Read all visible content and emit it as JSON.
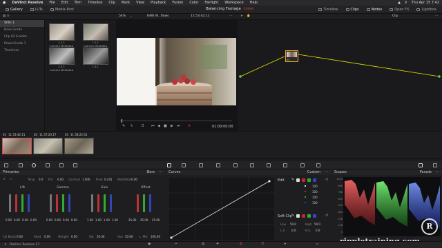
{
  "menubar": {
    "app": "DaVinci Resolve",
    "items": [
      "File",
      "Edit",
      "Trim",
      "Timeline",
      "Clip",
      "Mark",
      "View",
      "Playback",
      "Fusion",
      "Color",
      "Fairlight",
      "Workspace",
      "Help"
    ],
    "clock": "Thu Apr 15 7:42"
  },
  "toolbar": {
    "left": [
      "Gallery",
      "LUTs",
      "Media Pool"
    ],
    "project": "Balancing Footage",
    "edited": "Edited",
    "right": [
      "Timeline",
      "Clips",
      "Nodes",
      "Open FX",
      "Lightbox"
    ]
  },
  "viewer": {
    "zoom": "54%",
    "clip_name": "RAW W...flows",
    "timecode": "11:53:42:11",
    "playhead_tc": "01:00:00:00"
  },
  "nodes": {
    "mode": "Clip",
    "node_label": "01"
  },
  "sidebar": {
    "items": [
      "Stills 1",
      "Base Grade",
      "Clip 02 Grades",
      "PowerGrade 1",
      "Timelines"
    ]
  },
  "gallery": {
    "stills": [
      {
        "num": "1.1.1",
        "name": "Camera Metadata"
      },
      {
        "num": "1.2.1",
        "name": "Camera Metadata"
      },
      {
        "num": "1.3.1",
        "name": "Camera Metadata"
      },
      {
        "num": "1.4.1",
        "name": ""
      }
    ]
  },
  "timeline": {
    "clips": [
      {
        "index": "01",
        "tc": "11:53:42:11"
      },
      {
        "index": "02",
        "tc": "11:57:20:17"
      },
      {
        "index": "03",
        "tc": "11:58:22:01"
      }
    ]
  },
  "primaries": {
    "title": "Primaries",
    "mode": "Bars",
    "temp_label": "Temp",
    "temp": "0.0",
    "tint_label": "Tint",
    "tint": "0.00",
    "contrast_label": "Contrast",
    "contrast": "1.000",
    "pivot_label": "Pivot",
    "pivot": "0.435",
    "middetail_label": "Mid/Detail",
    "middetail": "0.00",
    "wheels": [
      {
        "name": "Lift",
        "values": [
          "0.00",
          "0.00",
          "0.00",
          "0.00"
        ]
      },
      {
        "name": "Gamma",
        "values": [
          "0.00",
          "0.00",
          "0.00",
          "0.00"
        ]
      },
      {
        "name": "Gain",
        "values": [
          "1.00",
          "1.00",
          "1.00",
          "1.00"
        ]
      },
      {
        "name": "Offset",
        "values": [
          "25.00",
          "25.00",
          "25.00"
        ]
      }
    ],
    "colboost_label": "Col Boost",
    "colboost": "0.00",
    "shad_label": "Shad",
    "shad": "0.00",
    "hilight_label": "Hi/Light",
    "hilight": "0.00",
    "sat_label": "Sat",
    "sat": "50.00",
    "hue_label": "Hue",
    "hue": "50.00",
    "lmix_label": "L. Mix",
    "lmix": "100.00"
  },
  "curves": {
    "title": "Curves",
    "mode": "Custom"
  },
  "edit": {
    "title": "Edit",
    "channels": [
      {
        "value": "100"
      },
      {
        "value": "100"
      },
      {
        "value": "100"
      },
      {
        "value": "100"
      }
    ],
    "softclip_title": "Soft Clip",
    "low_label": "Low",
    "low": "50.0",
    "high_label": "High",
    "high": "50.0",
    "ls_label": "L.S.",
    "ls": "0.0",
    "hs_label": "H.S.",
    "hs": "0.0"
  },
  "scopes": {
    "title": "Scopes",
    "mode": "Parade",
    "ticks": [
      "1023",
      "896",
      "768",
      "640",
      "512",
      "384",
      "256",
      "128",
      "0"
    ]
  },
  "footer": {
    "app_name": "DaVinci Resolve 17"
  },
  "watermark": {
    "text": "rippletraining.com"
  },
  "colors": {
    "accent": "#e04848",
    "background": "#1c1c1e",
    "panel": "#1e1e20",
    "node_line": "#e6e600",
    "selection": "#f0a020"
  }
}
